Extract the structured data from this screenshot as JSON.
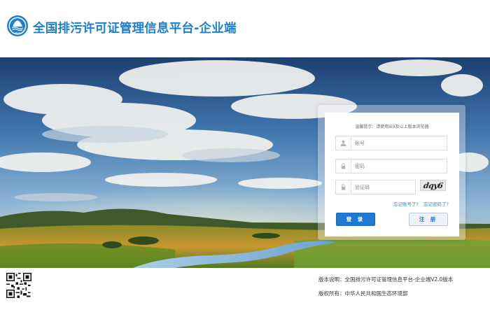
{
  "header": {
    "logo_text": "MEE",
    "site_title": "全国排污许可证管理信息平台-企业端"
  },
  "login": {
    "notice": "温馨提示：请使用IE9及以上版本浏览器",
    "account_placeholder": "帐号",
    "password_placeholder": "密码",
    "captcha_placeholder": "验证码",
    "captcha_text": "dqy6",
    "forgot_account": "忘记账号了?",
    "forgot_password": "忘记密码了?",
    "login_button": "登 录",
    "register_button": "注 册"
  },
  "icons": {
    "user": "user-icon",
    "lock": "lock-icon",
    "captcha_lock": "lock-icon",
    "qr": "qr-code-icon"
  },
  "footer": {
    "version": "版本说明：全国排污许可证管理信息平台-企业端V2.0版本",
    "copyright": "版权所有：中华人民共和国生态环境部"
  },
  "colors": {
    "brand_blue": "#1f7fc9",
    "login_button": "#1e78d4",
    "register_button_bg": "#eef2f7",
    "link": "#3a7fc4"
  }
}
